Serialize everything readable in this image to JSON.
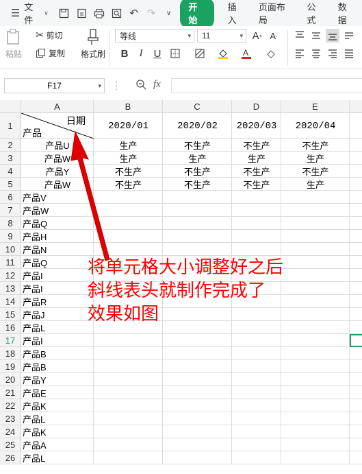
{
  "menu": {
    "file_label": "文件",
    "tabs": [
      "开始",
      "插入",
      "页面布局",
      "公式",
      "数据"
    ]
  },
  "ribbon": {
    "paste": "粘贴",
    "cut": "剪切",
    "copy": "复制",
    "format_painter": "格式刷",
    "font_name": "等线",
    "font_size": "11",
    "bold": "B",
    "italic": "I",
    "underline": "U"
  },
  "formula_bar": {
    "cell_ref": "F17",
    "fx": "fx",
    "value": ""
  },
  "sheet": {
    "columns": [
      "A",
      "B",
      "C",
      "D",
      "E"
    ],
    "rows": [
      "1",
      "2",
      "3",
      "4",
      "5",
      "6",
      "7",
      "8",
      "9",
      "10",
      "11",
      "12",
      "13",
      "14",
      "15",
      "16",
      "17",
      "18",
      "19",
      "20",
      "21",
      "22",
      "23",
      "24",
      "25",
      "26"
    ],
    "header": {
      "diag_top": "日期",
      "diag_bottom": "产品",
      "dates": [
        "2020/01",
        "2020/02",
        "2020/03",
        "2020/04"
      ]
    },
    "data_rows": [
      {
        "product": "产品U",
        "values": [
          "生产",
          "不生产",
          "不生产",
          "不生产"
        ]
      },
      {
        "product": "产品W",
        "values": [
          "生产",
          "生产",
          "生产",
          "生产"
        ]
      },
      {
        "product": "产品Y",
        "values": [
          "不生产",
          "不生产",
          "不生产",
          "不生产"
        ]
      },
      {
        "product": "产品W",
        "values": [
          "不生产",
          "不生产",
          "不生产",
          "生产"
        ]
      }
    ],
    "list_items": [
      "产品V",
      "产品W",
      "产品Q",
      "产品H",
      "产品N",
      "产品Q",
      "产品I",
      "产品I",
      "产品R",
      "产品J",
      "产品L",
      "产品I",
      "产品B",
      "产品B",
      "产品Y",
      "产品E",
      "产品K",
      "产品L",
      "产品K",
      "产品A",
      "产品L"
    ]
  },
  "annotation": {
    "lines": [
      "将单元格大小调整好之后",
      "斜线表头就制作完成了",
      "效果如图"
    ],
    "color": "#ff0000"
  },
  "accent": "#1aa260"
}
